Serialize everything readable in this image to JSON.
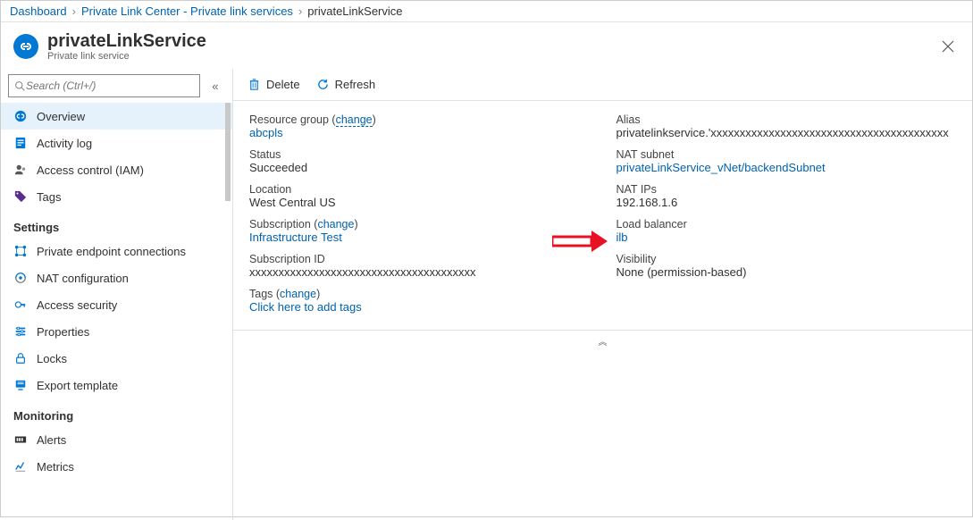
{
  "breadcrumb": {
    "dashboard": "Dashboard",
    "center": "Private Link Center - Private link services",
    "service": "privateLinkService"
  },
  "header": {
    "title": "privateLinkService",
    "subtitle": "Private link service"
  },
  "search": {
    "placeholder": "Search (Ctrl+/)"
  },
  "sidebar": {
    "overview": "Overview",
    "activity": "Activity log",
    "iam": "Access control (IAM)",
    "tags": "Tags",
    "settings": "Settings",
    "pec": "Private endpoint connections",
    "nat": "NAT configuration",
    "accsec": "Access security",
    "props": "Properties",
    "locks": "Locks",
    "export": "Export template",
    "monitoring": "Monitoring",
    "alerts": "Alerts",
    "metrics": "Metrics"
  },
  "toolbar": {
    "delete": "Delete",
    "refresh": "Refresh"
  },
  "left": {
    "rg_lbl": "Resource group",
    "rg_change": "change",
    "rg_val": "abcpls",
    "status_lbl": "Status",
    "status_val": "Succeeded",
    "loc_lbl": "Location",
    "loc_val": "West Central US",
    "sub_lbl": "Subscription",
    "sub_change": "change",
    "sub_val": "Infrastructure Test",
    "subid_lbl": "Subscription ID",
    "subid_val": "xxxxxxxxxxxxxxxxxxxxxxxxxxxxxxxxxxxxxxx",
    "tags_lbl": "Tags",
    "tags_change": "change",
    "tags_add": "Click here to add tags"
  },
  "right": {
    "alias_lbl": "Alias",
    "alias_val": "privatelinkservice.'xxxxxxxxxxxxxxxxxxxxxxxxxxxxxxxxxxxxxxxxx",
    "natsub_lbl": "NAT subnet",
    "natsub_val": "privateLinkService_vNet/backendSubnet",
    "natip_lbl": "NAT IPs",
    "natip_val": "192.168.1.6",
    "lb_lbl": "Load balancer",
    "lb_val": "ilb",
    "vis_lbl": "Visibility",
    "vis_val": "None (permission-based)"
  }
}
